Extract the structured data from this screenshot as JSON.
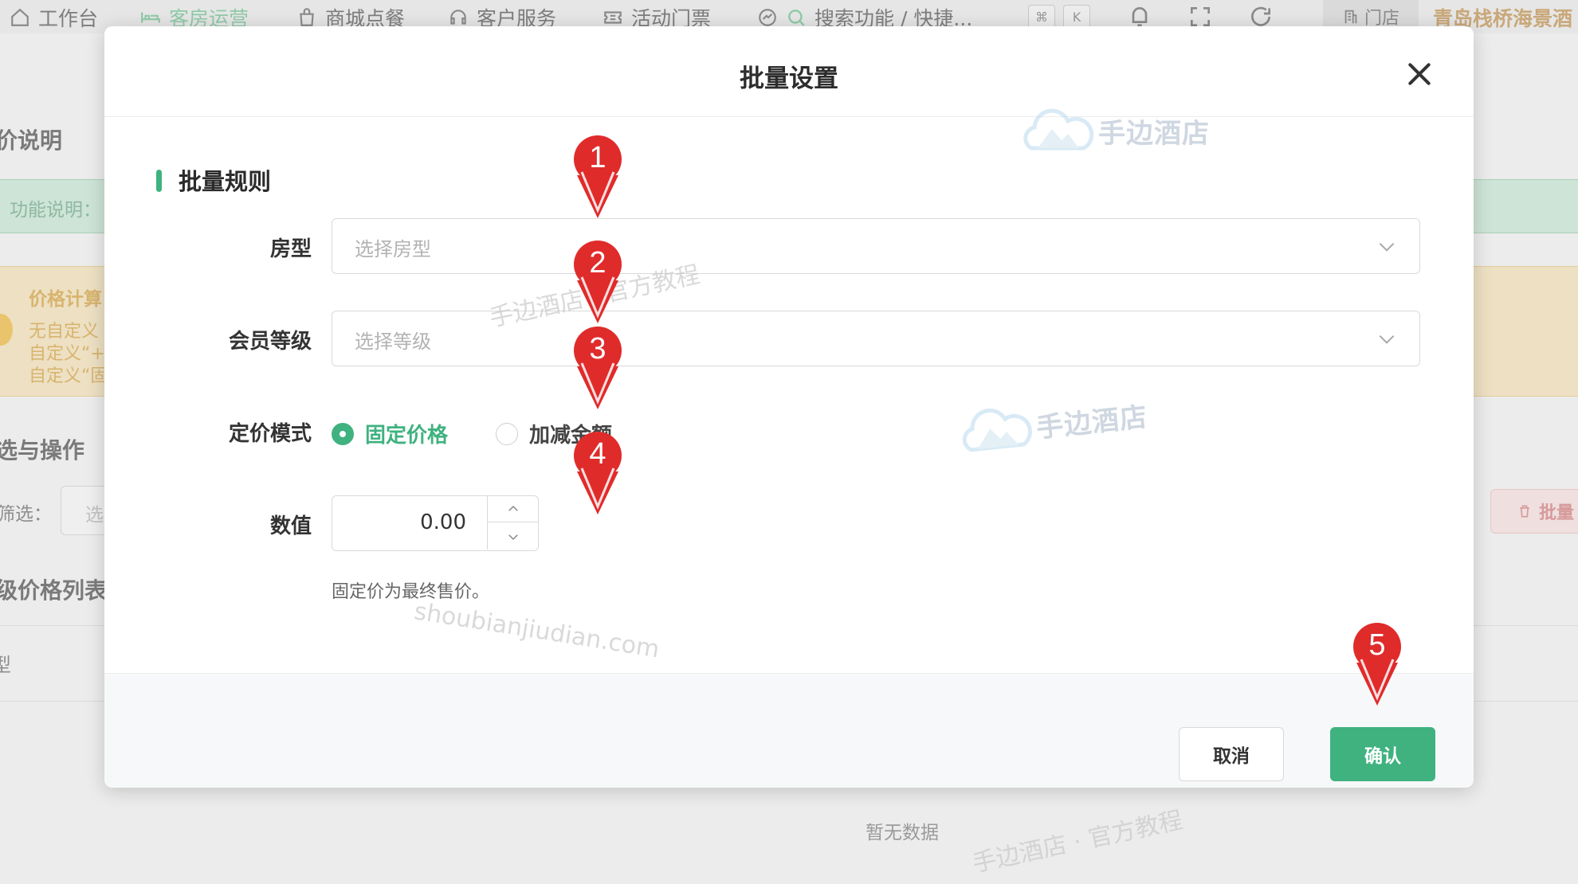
{
  "topnav": {
    "items": [
      {
        "label": "工作台",
        "icon": "home-icon"
      },
      {
        "label": "客房运营",
        "icon": "bed-icon"
      },
      {
        "label": "商城点餐",
        "icon": "bag-icon"
      },
      {
        "label": "客户服务",
        "icon": "headset-icon"
      },
      {
        "label": "活动门票",
        "icon": "ticket-icon"
      }
    ],
    "search_label": "搜索功能 / 快捷...",
    "kbd_cmd": "⌘",
    "kbd_k": "K",
    "store_label": "门店",
    "hotel_name": "青岛栈桥海景酒"
  },
  "background": {
    "section_desc": "价说明",
    "func_desc": "功能说明：",
    "calc_title": "价格计算",
    "calc_lines": [
      "无自定义",
      "自定义“+",
      "自定义“固"
    ],
    "filter_title": "选与操作",
    "filter_label": "筛选：",
    "filter_input_ph": "选",
    "batch_delete": "批量",
    "list_title": "级价格列表",
    "row_label": "型",
    "empty": "暂无数据"
  },
  "modal": {
    "title": "批量设置",
    "section_title": "批量规则",
    "room_type": {
      "label": "房型",
      "placeholder": "选择房型"
    },
    "member_level": {
      "label": "会员等级",
      "placeholder": "选择等级"
    },
    "pricing_mode": {
      "label": "定价模式",
      "options": [
        {
          "label": "固定价格",
          "checked": true
        },
        {
          "label": "加减金额",
          "checked": false
        }
      ]
    },
    "value": {
      "label": "数值",
      "value": "0.00"
    },
    "hint": "固定价为最终售价。",
    "cancel_label": "取消",
    "confirm_label": "确认"
  },
  "watermarks": {
    "brand": "手边酒店",
    "tutorial_1": "手边酒店 · 官方教程",
    "url": "shoubianjiudian.com",
    "tutorial_2": "手边酒店 · 官方教程"
  },
  "markers": [
    "1",
    "2",
    "3",
    "4",
    "5"
  ],
  "colors": {
    "accent": "#3fb27f",
    "marker": "#e02b2b",
    "hotel_name": "#c9a87a"
  }
}
